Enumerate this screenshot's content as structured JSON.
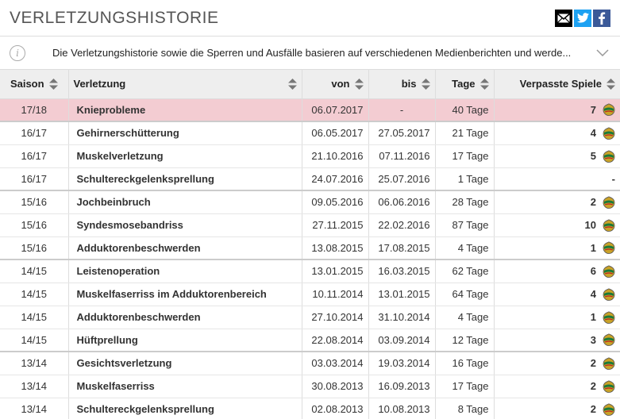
{
  "header": {
    "title": "VERLETZUNGSHISTORIE"
  },
  "share": {
    "icons": [
      "mail-icon",
      "twitter-icon",
      "facebook-icon"
    ],
    "colors": {
      "mail": "#000000",
      "twitter": "#1da1f2",
      "facebook": "#3b5998"
    }
  },
  "info": {
    "text": "Die Verletzungshistorie sowie die Sperren und Ausfälle basieren auf verschiedenen Medienberichten und werde..."
  },
  "table": {
    "columns": [
      "Saison",
      "Verletzung",
      "von",
      "bis",
      "Tage",
      "Verpasste Spiele"
    ],
    "highlight_color": "#f3ccd2",
    "rows": [
      {
        "season": "17/18",
        "injury": "Knieprobleme",
        "from": "06.07.2017",
        "to": "-",
        "days": "40 Tage",
        "games": "7"
      },
      {
        "season": "16/17",
        "injury": "Gehirnerschütterung",
        "from": "06.05.2017",
        "to": "27.05.2017",
        "days": "21 Tage",
        "games": "4"
      },
      {
        "season": "16/17",
        "injury": "Muskelverletzung",
        "from": "21.10.2016",
        "to": "07.11.2016",
        "days": "17 Tage",
        "games": "5"
      },
      {
        "season": "16/17",
        "injury": "Schultereckgelenksprellung",
        "from": "24.07.2016",
        "to": "25.07.2016",
        "days": "1 Tage",
        "games": "-"
      },
      {
        "season": "15/16",
        "injury": "Jochbeinbruch",
        "from": "09.05.2016",
        "to": "06.06.2016",
        "days": "28 Tage",
        "games": "2"
      },
      {
        "season": "15/16",
        "injury": "Syndesmosebandriss",
        "from": "27.11.2015",
        "to": "22.02.2016",
        "days": "87 Tage",
        "games": "10"
      },
      {
        "season": "15/16",
        "injury": "Adduktorenbeschwerden",
        "from": "13.08.2015",
        "to": "17.08.2015",
        "days": "4 Tage",
        "games": "1"
      },
      {
        "season": "14/15",
        "injury": "Leistenoperation",
        "from": "13.01.2015",
        "to": "16.03.2015",
        "days": "62 Tage",
        "games": "6"
      },
      {
        "season": "14/15",
        "injury": "Muskelfaserriss im Adduktorenbereich",
        "from": "10.11.2014",
        "to": "13.01.2015",
        "days": "64 Tage",
        "games": "4"
      },
      {
        "season": "14/15",
        "injury": "Adduktorenbeschwerden",
        "from": "27.10.2014",
        "to": "31.10.2014",
        "days": "4 Tage",
        "games": "1"
      },
      {
        "season": "14/15",
        "injury": "Hüftprellung",
        "from": "22.08.2014",
        "to": "03.09.2014",
        "days": "12 Tage",
        "games": "3"
      },
      {
        "season": "13/14",
        "injury": "Gesichtsverletzung",
        "from": "03.03.2014",
        "to": "19.03.2014",
        "days": "16 Tage",
        "games": "2"
      },
      {
        "season": "13/14",
        "injury": "Muskelfaserriss",
        "from": "30.08.2013",
        "to": "16.09.2013",
        "days": "17 Tage",
        "games": "2"
      },
      {
        "season": "13/14",
        "injury": "Schultereckgelenksprellung",
        "from": "02.08.2013",
        "to": "10.08.2013",
        "days": "8 Tage",
        "games": "2"
      }
    ]
  }
}
